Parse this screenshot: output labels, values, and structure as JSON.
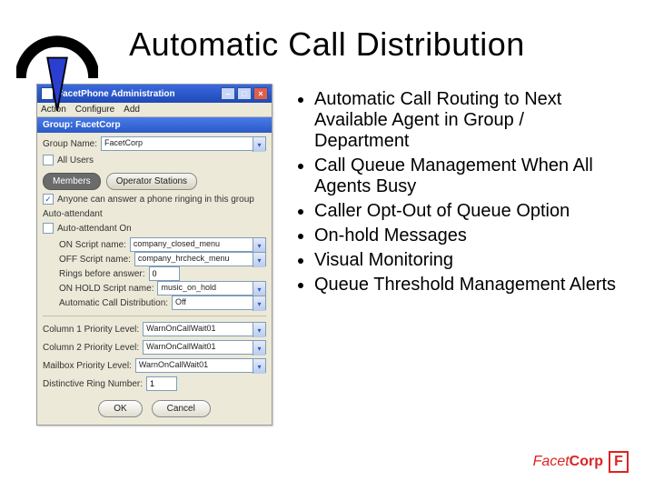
{
  "title": "Automatic Call Distribution",
  "bullets": [
    "Automatic Call Routing to Next Available Agent in Group / Department",
    "Call Queue Management When All Agents Busy",
    "Caller Opt-Out of Queue Option",
    "On-hold Messages",
    "Visual Monitoring",
    "Queue Threshold Management Alerts"
  ],
  "window": {
    "title": "FacetPhone Administration",
    "menus": [
      "Action",
      "Configure",
      "Add"
    ],
    "group_header": "Group: FacetCorp",
    "group_name_label": "Group Name:",
    "group_name_value": "FacetCorp",
    "all_users_label": "All Users",
    "tabs": {
      "members": "Members",
      "operator": "Operator Stations"
    },
    "anyone_label": "Anyone can answer a phone ringing in this group",
    "auto_attendant_label": "Auto-attendant",
    "auto_on_label": "Auto-attendant On",
    "fields": {
      "on_script_label": "ON Script name:",
      "on_script_value": "company_closed_menu",
      "off_script_label": "OFF Script name:",
      "off_script_value": "company_hrcheck_menu",
      "rings_label": "Rings before answer:",
      "rings_value": "0",
      "onhold_label": "ON HOLD Script name:",
      "onhold_value": "music_on_hold",
      "acd_label": "Automatic Call Distribution:",
      "acd_value": "Off"
    },
    "lower": {
      "col1_label": "Column 1 Priority Level:",
      "col1_value": "WarnOnCallWait01",
      "col2_label": "Column 2 Priority Level:",
      "col2_value": "WarnOnCallWait01",
      "mailbox_label": "Mailbox Priority Level:",
      "mailbox_value": "WarnOnCallWait01",
      "ringnum_label": "Distinctive Ring Number:",
      "ringnum_value": "1"
    },
    "buttons": {
      "ok": "OK",
      "cancel": "Cancel"
    }
  },
  "footer": {
    "brand_a": "Facet",
    "brand_b": "Corp",
    "mono": "F"
  }
}
